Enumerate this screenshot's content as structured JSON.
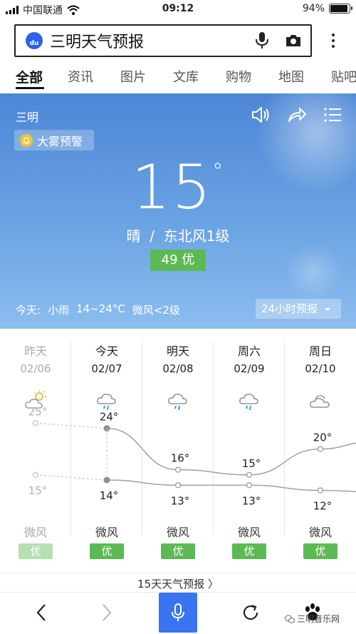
{
  "status": {
    "carrier": "中国联通",
    "time": "09:12",
    "battery": "94%",
    "battery_level": 0.94
  },
  "search": {
    "query": "三明天气预报"
  },
  "tabs": [
    "全部",
    "资讯",
    "图片",
    "文库",
    "购物",
    "地图",
    "贴吧"
  ],
  "weather": {
    "city": "三明",
    "alert": "大雾预警",
    "temp": "15",
    "temp_unit": "°",
    "condition": "晴",
    "separator": "/",
    "wind": "东北风1级",
    "aqi": "49 优",
    "today_label": "今天:",
    "today_cond": "小雨",
    "today_range": "14~24°C",
    "today_wind": "微风<2级",
    "hourly_button": "24小时预报"
  },
  "forecast": [
    {
      "day": "昨天",
      "date": "02/06",
      "icon": "partly-sunny-icon",
      "high": "25°",
      "low": "15°",
      "wind": "微风",
      "aqi": "优",
      "past": true
    },
    {
      "day": "今天",
      "date": "02/07",
      "icon": "rain-icon",
      "high": "24°",
      "low": "14°",
      "wind": "微风",
      "aqi": "优",
      "past": false
    },
    {
      "day": "明天",
      "date": "02/08",
      "icon": "rain-icon",
      "high": "16°",
      "low": "13°",
      "wind": "微风",
      "aqi": "优",
      "past": false
    },
    {
      "day": "周六",
      "date": "02/09",
      "icon": "rain-icon",
      "high": "15°",
      "low": "13°",
      "wind": "微风",
      "aqi": "优",
      "past": false
    },
    {
      "day": "周日",
      "date": "02/10",
      "icon": "cloudy-icon",
      "high": "20°",
      "low": "12°",
      "wind": "微风",
      "aqi": "优",
      "past": false
    }
  ],
  "chart_data": {
    "type": "line",
    "categories": [
      "02/06",
      "02/07",
      "02/08",
      "02/09",
      "02/10"
    ],
    "series": [
      {
        "values": [
          25,
          24,
          16,
          15,
          20
        ]
      },
      {
        "values": [
          15,
          14,
          13,
          13,
          12
        ]
      }
    ]
  },
  "fifteen_day_link": "15天天气预报",
  "fifteen_day_arrow": "〉",
  "watermark": "三明音乐网",
  "colors": {
    "accent": "#3a74f0",
    "good_aqi": "#5cba55",
    "card_top": "#4d86d6"
  }
}
